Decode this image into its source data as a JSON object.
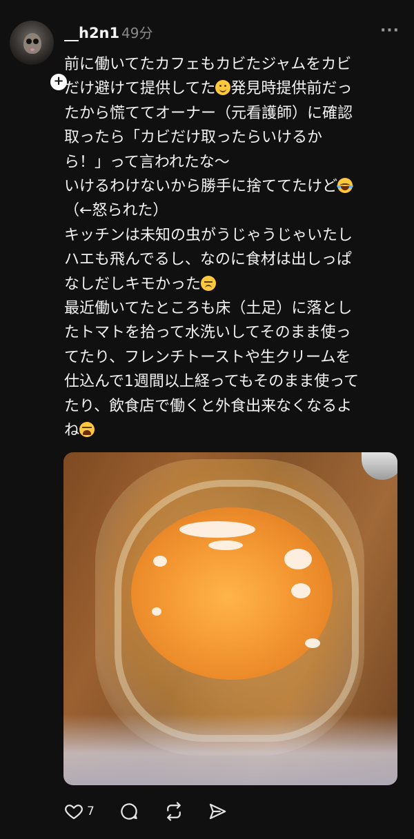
{
  "post": {
    "username": "__h2n1",
    "time": "49分",
    "more_label": "···",
    "follow_badge": "+",
    "body_lines": [
      {
        "text": "前に働いてたカフェもカビたジャムをカビ",
        "emoji": ""
      },
      {
        "text": "だけ避けて提供してた",
        "emoji": "slightly-smiling-face"
      },
      {
        "text": "発見時提供前だっ",
        "emoji": ""
      },
      {
        "text": "たから慌ててオーナー（元看護師）に確認",
        "emoji": ""
      },
      {
        "text": "取ったら「カビだけ取ったらいけるか",
        "emoji": ""
      },
      {
        "text": "ら！」って言われたな〜",
        "emoji": ""
      },
      {
        "text": "いけるわけないから勝手に捨ててたけど",
        "emoji": "face-with-tears-of-joy"
      },
      {
        "text": "（←怒られた）",
        "emoji": ""
      },
      {
        "text": "キッチンは未知の虫がうじゃうじゃいたし",
        "emoji": ""
      },
      {
        "text": "ハエも飛んでるし、なのに食材は出しっぱ",
        "emoji": ""
      },
      {
        "text": "なしだしキモかった",
        "emoji": "disappointed-face"
      },
      {
        "text": "最近働いてたところも床（土足）に落とし",
        "emoji": ""
      },
      {
        "text": "たトマトを拾って水洗いしてそのまま使っ",
        "emoji": ""
      },
      {
        "text": "てたり、フレンチトーストや生クリームを",
        "emoji": ""
      },
      {
        "text": "仕込んで1週間以上経ってもそのまま使って",
        "emoji": ""
      },
      {
        "text": "たり、飲食店で働くと外食出来なくなるよ",
        "emoji": ""
      },
      {
        "text": "ね",
        "emoji": "tired-face"
      }
    ],
    "actions": {
      "like_count": "7",
      "like_icon": "heart-icon",
      "comment_icon": "comment-icon",
      "repost_icon": "repost-icon",
      "share_icon": "send-icon"
    }
  }
}
